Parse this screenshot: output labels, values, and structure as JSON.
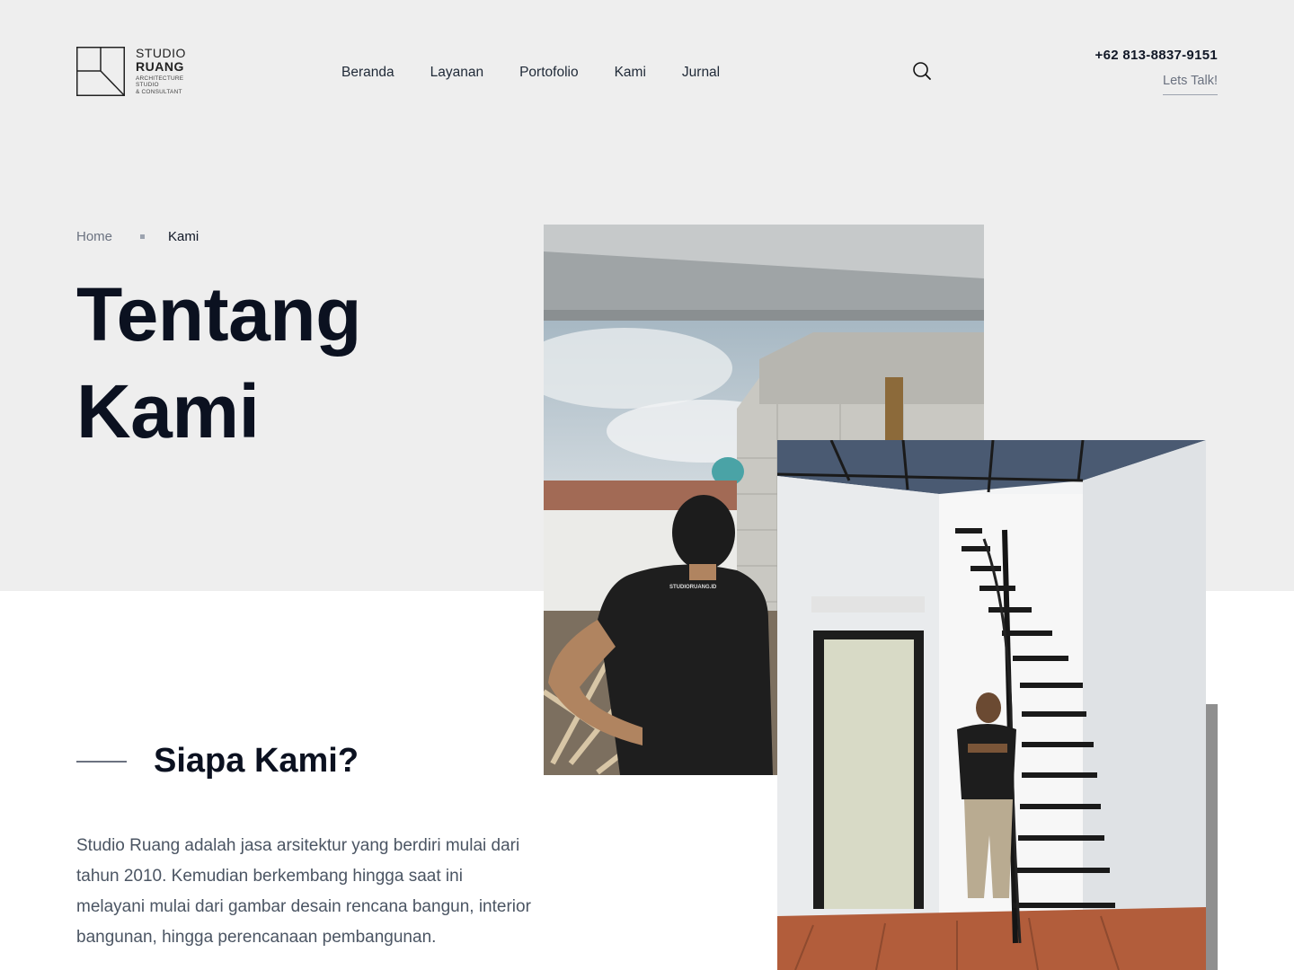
{
  "brand": {
    "line1": "STUDIO",
    "line2": "RUANG",
    "sub1": "ARCHITECTURE",
    "sub2": "STUDIO",
    "sub3": "& CONSULTANT"
  },
  "nav": {
    "items": [
      {
        "label": "Beranda"
      },
      {
        "label": "Layanan"
      },
      {
        "label": "Portofolio"
      },
      {
        "label": "Kami"
      },
      {
        "label": "Jurnal"
      }
    ]
  },
  "header": {
    "search_icon": "search-icon",
    "phone": "+62 813-8837-9151",
    "cta": "Lets Talk!"
  },
  "breadcrumb": {
    "home": "Home",
    "current": "Kami"
  },
  "hero": {
    "title_line1": "Tentang",
    "title_line2": "Kami"
  },
  "section": {
    "title": "Siapa Kami?",
    "body": "Studio Ruang adalah jasa arsitektur yang berdiri mulai dari tahun 2010. Kemudian berkembang hingga saat ini melayani mulai dari gambar desain rencana bangun, interior bangunan, hingga perencanaan pembangunan."
  },
  "photos": {
    "photo1_print": "STUDIORUANG.ID"
  },
  "colors": {
    "hero_bg": "#eeeeee",
    "text_dark": "#0b1120",
    "text_muted": "#4b5563"
  }
}
